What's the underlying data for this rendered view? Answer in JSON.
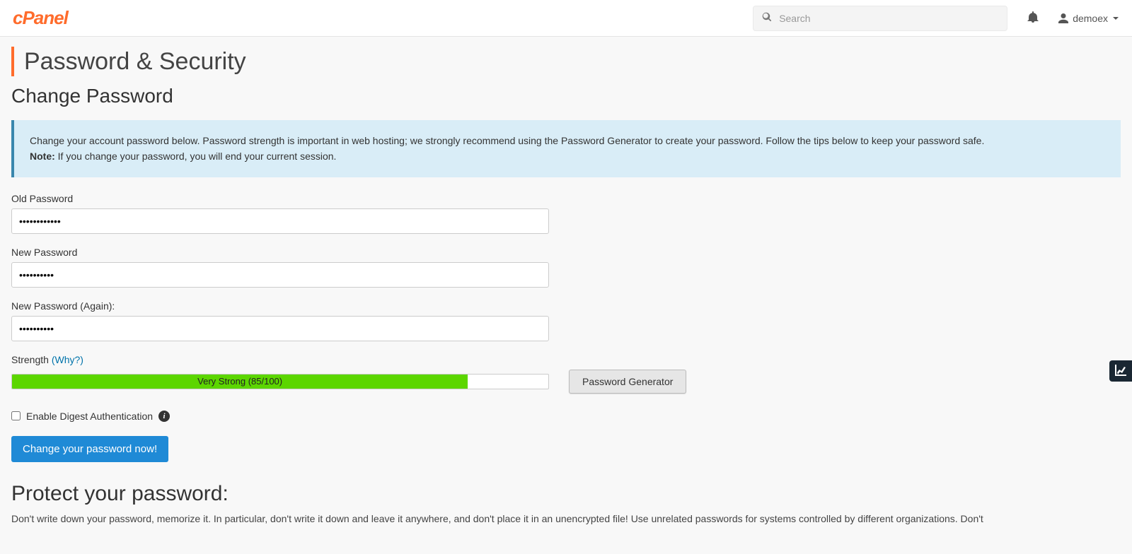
{
  "header": {
    "logo_text": "cPanel",
    "search_placeholder": "Search",
    "username": "demoex"
  },
  "page": {
    "title": "Password & Security",
    "section_title": "Change Password",
    "callout_main": "Change your account password below. Password strength is important in web hosting; we strongly recommend using the Password Generator to create your password. Follow the tips below to keep your password safe.",
    "callout_note_label": "Note:",
    "callout_note_text": " If you change your password, you will end your current session."
  },
  "form": {
    "old_pw_label": "Old Password",
    "old_pw_value": "••••••••••••",
    "new_pw_label": "New Password",
    "new_pw_value": "••••••••••",
    "confirm_pw_label": "New Password (Again):",
    "confirm_pw_value": "••••••••••",
    "strength_label_prefix": "Strength ",
    "strength_why": "(Why?)",
    "strength_percent": 85,
    "strength_text": "Very Strong (85/100)",
    "generator_btn": "Password Generator",
    "digest_label": "Enable Digest Authentication",
    "submit_btn": "Change your password now!"
  },
  "protect": {
    "title": "Protect your password:",
    "body": "Don't write down your password, memorize it. In particular, don't write it down and leave it anywhere, and don't place it in an unencrypted file! Use unrelated passwords for systems controlled by different organizations. Don't"
  }
}
